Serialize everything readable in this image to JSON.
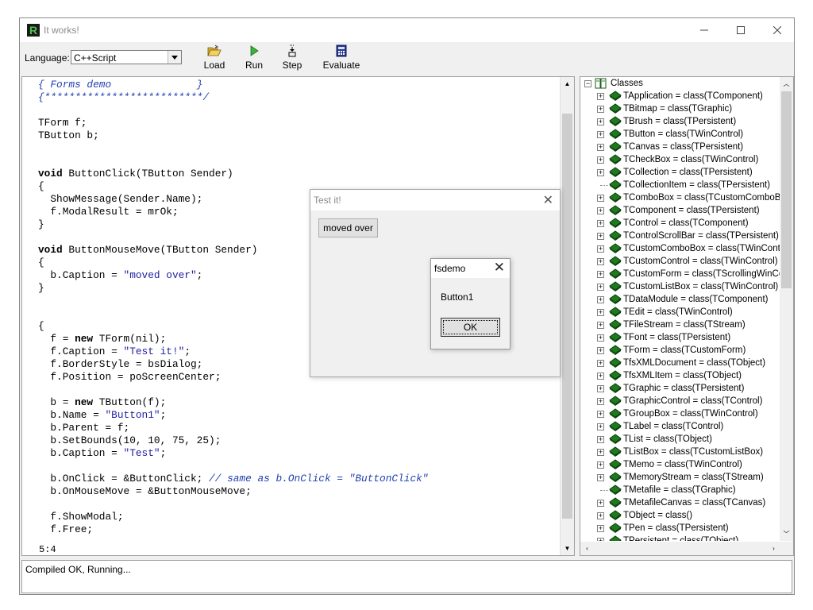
{
  "window": {
    "title": "It works!"
  },
  "toolbar": {
    "language_label": "Language:",
    "language_value": "C++Script",
    "buttons": [
      {
        "label": "Load",
        "icon": "folder-open-icon"
      },
      {
        "label": "Run",
        "icon": "play-icon"
      },
      {
        "label": "Step",
        "icon": "step-icon"
      },
      {
        "label": "Evaluate",
        "icon": "calculator-icon"
      }
    ]
  },
  "editor": {
    "lines": [
      "{ Forms demo              }",
      "{**************************/",
      "",
      "TForm f;",
      "TButton b;",
      "",
      "",
      "void ButtonClick(TButton Sender)",
      "{",
      "  ShowMessage(Sender.Name);",
      "  f.ModalResult = mrOk;",
      "}",
      "",
      "void ButtonMouseMove(TButton Sender)",
      "{",
      "  b.Caption = \"moved over\";",
      "}",
      "",
      "",
      "{",
      "  f = new TForm(nil);",
      "  f.Caption = \"Test it!\";",
      "  f.BorderStyle = bsDialog;",
      "  f.Position = poScreenCenter;",
      "",
      "  b = new TButton(f);",
      "  b.Name = \"Button1\";",
      "  b.Parent = f;",
      "  b.SetBounds(10, 10, 75, 25);",
      "  b.Caption = \"Test\";",
      "",
      "  b.OnClick = &ButtonClick; // same as b.OnClick = \"ButtonClick\"",
      "  b.OnMouseMove = &ButtonMouseMove;",
      "",
      "  f.ShowModal;",
      "  f.Free;"
    ],
    "cursor_position": "5:4"
  },
  "tree": {
    "root_label": "Classes",
    "items": [
      {
        "label": "TApplication = class(TComponent)",
        "expandable": true
      },
      {
        "label": "TBitmap = class(TGraphic)",
        "expandable": true
      },
      {
        "label": "TBrush = class(TPersistent)",
        "expandable": true
      },
      {
        "label": "TButton = class(TWinControl)",
        "expandable": true
      },
      {
        "label": "TCanvas = class(TPersistent)",
        "expandable": true
      },
      {
        "label": "TCheckBox = class(TWinControl)",
        "expandable": true
      },
      {
        "label": "TCollection = class(TPersistent)",
        "expandable": true
      },
      {
        "label": "TCollectionItem = class(TPersistent)",
        "expandable": false
      },
      {
        "label": "TComboBox = class(TCustomComboBox)",
        "expandable": true
      },
      {
        "label": "TComponent = class(TPersistent)",
        "expandable": true
      },
      {
        "label": "TControl = class(TComponent)",
        "expandable": true
      },
      {
        "label": "TControlScrollBar = class(TPersistent)",
        "expandable": true
      },
      {
        "label": "TCustomComboBox = class(TWinControl",
        "expandable": true
      },
      {
        "label": "TCustomControl = class(TWinControl)",
        "expandable": true
      },
      {
        "label": "TCustomForm = class(TScrollingWinCont",
        "expandable": true
      },
      {
        "label": "TCustomListBox = class(TWinControl)",
        "expandable": true
      },
      {
        "label": "TDataModule = class(TComponent)",
        "expandable": true
      },
      {
        "label": "TEdit = class(TWinControl)",
        "expandable": true
      },
      {
        "label": "TFileStream = class(TStream)",
        "expandable": true
      },
      {
        "label": "TFont = class(TPersistent)",
        "expandable": true
      },
      {
        "label": "TForm = class(TCustomForm)",
        "expandable": true
      },
      {
        "label": "TfsXMLDocument = class(TObject)",
        "expandable": true
      },
      {
        "label": "TfsXMLItem = class(TObject)",
        "expandable": true
      },
      {
        "label": "TGraphic = class(TPersistent)",
        "expandable": true
      },
      {
        "label": "TGraphicControl = class(TControl)",
        "expandable": true
      },
      {
        "label": "TGroupBox = class(TWinControl)",
        "expandable": true
      },
      {
        "label": "TLabel = class(TControl)",
        "expandable": true
      },
      {
        "label": "TList = class(TObject)",
        "expandable": true
      },
      {
        "label": "TListBox = class(TCustomListBox)",
        "expandable": true
      },
      {
        "label": "TMemo = class(TWinControl)",
        "expandable": true
      },
      {
        "label": "TMemoryStream = class(TStream)",
        "expandable": true
      },
      {
        "label": "TMetafile = class(TGraphic)",
        "expandable": false
      },
      {
        "label": "TMetafileCanvas = class(TCanvas)",
        "expandable": true
      },
      {
        "label": "TObject = class()",
        "expandable": true
      },
      {
        "label": "TPen = class(TPersistent)",
        "expandable": true
      },
      {
        "label": "TPersistent = class(TObject)",
        "expandable": true
      }
    ]
  },
  "output": {
    "text": "Compiled OK, Running..."
  },
  "form_dialog": {
    "title": "Test it!",
    "button_label": "moved over"
  },
  "message_box": {
    "title": "fsdemo",
    "text": "Button1",
    "ok_label": "OK"
  },
  "colors": {
    "class_icon": "#1f7a1f",
    "string": "#1f1fa0",
    "comment": "#1f3fb0"
  }
}
